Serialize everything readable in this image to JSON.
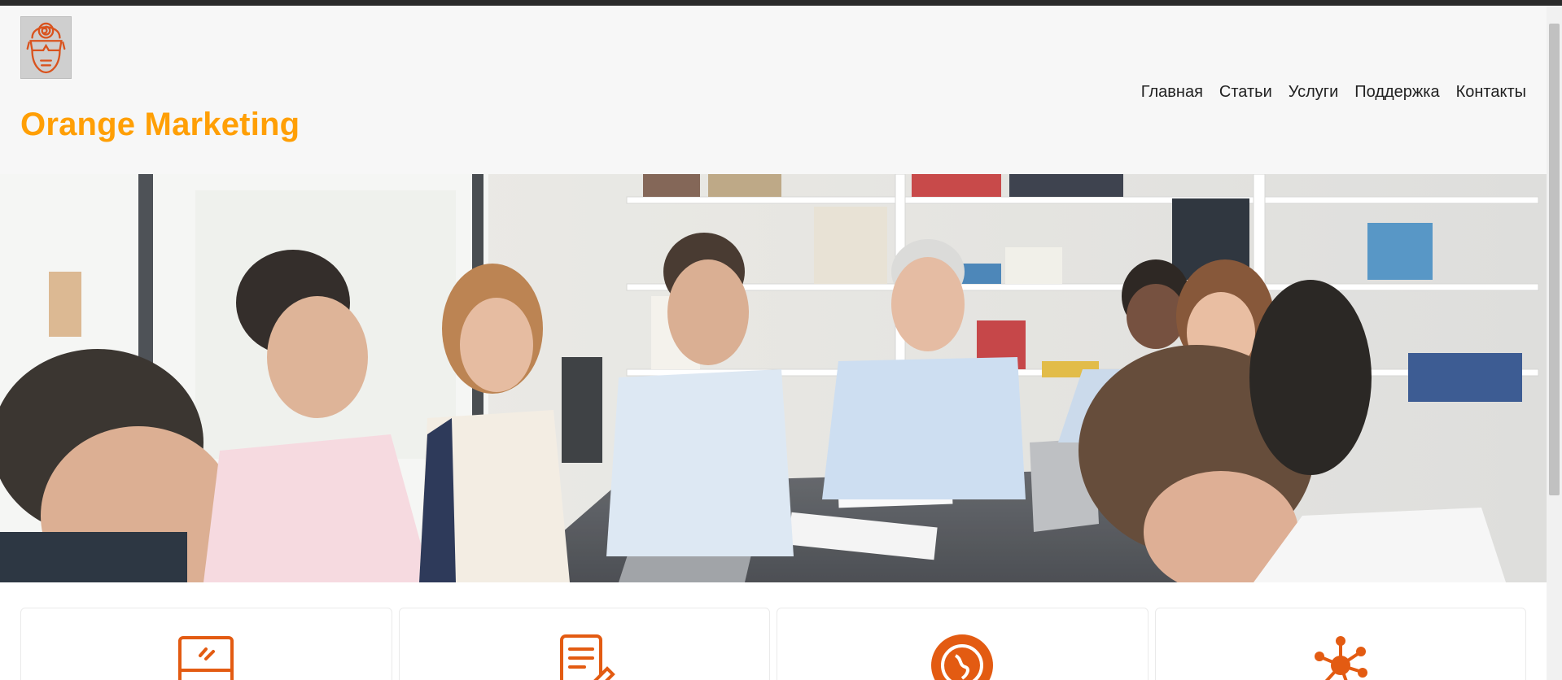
{
  "site": {
    "brand": "Orange Marketing",
    "brand_color": "#ff9f05",
    "logo_icon": "hypnotic-face-logo"
  },
  "nav": {
    "items": [
      {
        "label": "Главная"
      },
      {
        "label": "Статьи"
      },
      {
        "label": "Услуги"
      },
      {
        "label": "Поддержка"
      },
      {
        "label": "Контакты"
      }
    ]
  },
  "hero": {
    "image": "office-meeting-photo"
  },
  "features": {
    "accent_color": "#e35b12",
    "cards": [
      {
        "icon": "monitor-icon"
      },
      {
        "icon": "document-edit-icon"
      },
      {
        "icon": "globe-icon"
      },
      {
        "icon": "network-icon"
      }
    ]
  }
}
